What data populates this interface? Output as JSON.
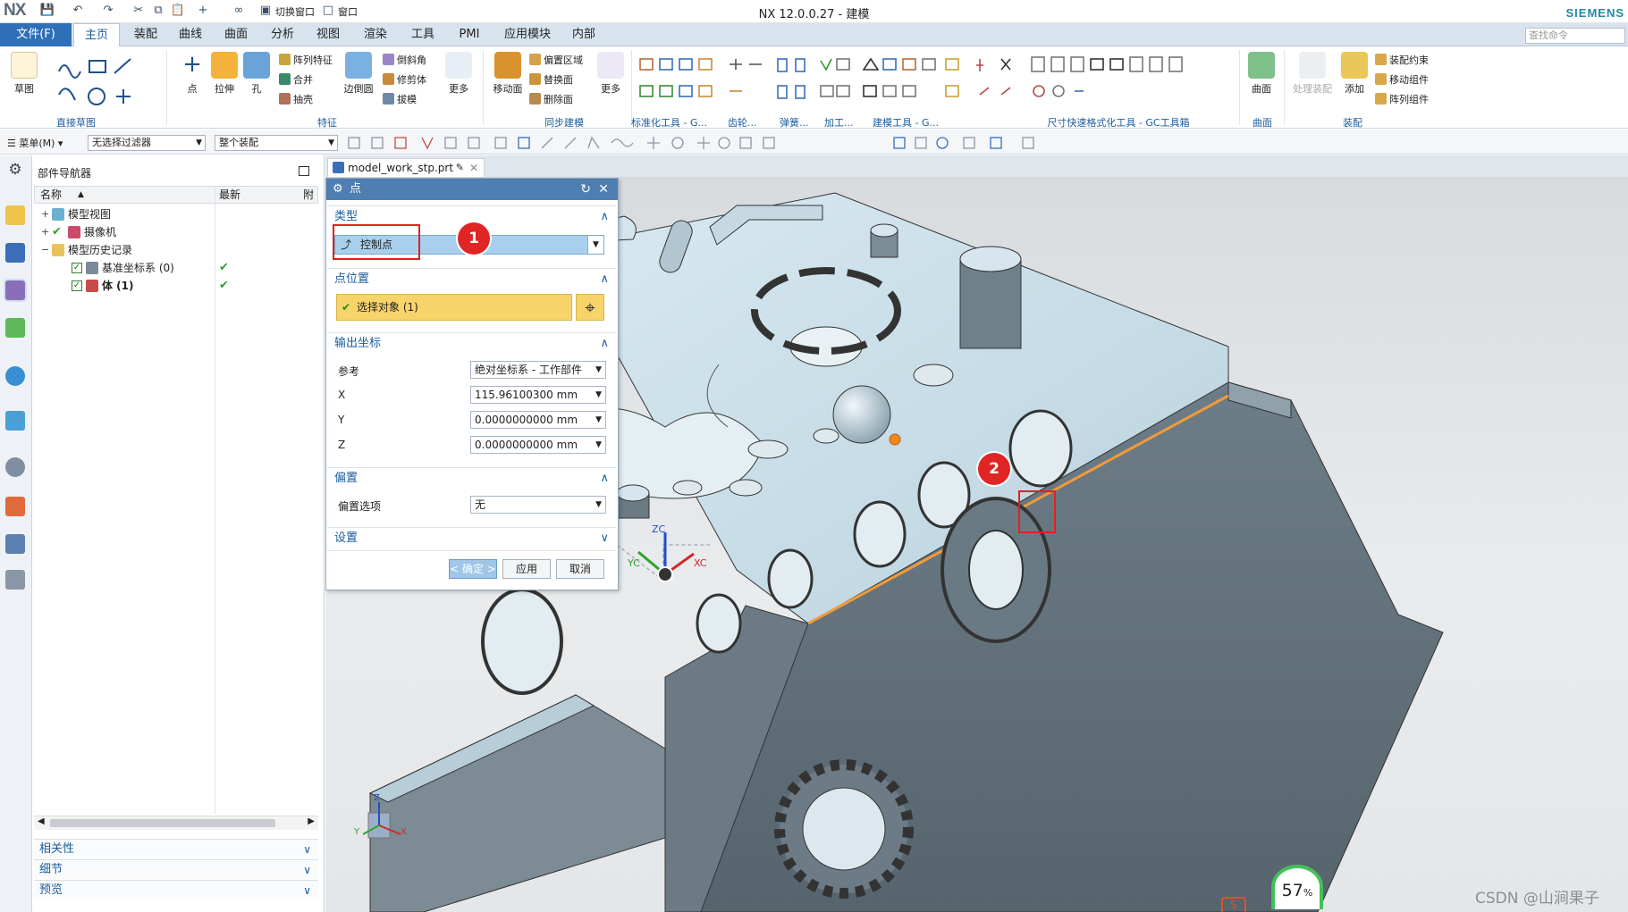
{
  "titlebar": {
    "logo": "NX",
    "title": "NX 12.0.0.27 - 建模",
    "brand": "SIEMENS",
    "switch_window": "切换窗口",
    "window_menu": "窗口"
  },
  "menubar": {
    "file": "文件(F)",
    "tabs": [
      "主页",
      "装配",
      "曲线",
      "曲面",
      "分析",
      "视图",
      "渲染",
      "工具",
      "PMI",
      "应用模块",
      "内部"
    ],
    "active_tab": "主页",
    "search_placeholder": "查找命令"
  },
  "ribbon": {
    "groups": [
      {
        "label": "直接草图",
        "buttons": [
          "草图"
        ]
      },
      {
        "label": "特征",
        "buttons": [
          "点",
          "拉伸",
          "孔",
          "边倒圆",
          "更多"
        ],
        "small": [
          "阵列特征",
          "合并",
          "抽壳",
          "倒斜角",
          "修剪体",
          "拔模"
        ]
      },
      {
        "label": "同步建模",
        "buttons": [
          "移动面",
          "更多"
        ],
        "small": [
          "偏置区域",
          "替换面",
          "删除面"
        ]
      },
      {
        "label": "标准化工具 - G...",
        "buttons": []
      },
      {
        "label": "齿轮...",
        "buttons": []
      },
      {
        "label": "弹簧...",
        "buttons": []
      },
      {
        "label": "加工...",
        "buttons": []
      },
      {
        "label": "建模工具 - G...",
        "buttons": []
      },
      {
        "label": "尺寸快速格式化工具 - GC工具箱",
        "buttons": []
      },
      {
        "label": "曲面",
        "buttons": [
          "曲面"
        ]
      },
      {
        "label": "装配",
        "buttons": [
          "处理装配",
          "添加"
        ],
        "small": [
          "装配约束",
          "移动组件",
          "阵列组件"
        ]
      }
    ]
  },
  "selbar": {
    "menu": "菜单(M)",
    "filter": "无选择过滤器",
    "scope": "整个装配"
  },
  "navigator": {
    "title": "部件导航器",
    "columns": [
      "名称",
      "最新",
      "附"
    ],
    "rows": [
      {
        "toggle": "+",
        "label": "模型视图",
        "checked": false,
        "ok": false
      },
      {
        "toggle": "+",
        "label": "摄像机",
        "checked": true,
        "ok": false
      },
      {
        "toggle": "−",
        "label": "模型历史记录",
        "checked": false,
        "ok": false
      },
      {
        "toggle": "",
        "label": "基准坐标系 (0)",
        "checked": true,
        "ok": true
      },
      {
        "toggle": "",
        "label": "体 (1)",
        "checked": true,
        "ok": true
      }
    ],
    "accordions": [
      "相关性",
      "细节",
      "预览"
    ]
  },
  "doc_tab": {
    "name": "model_work_stp.prt"
  },
  "dialog": {
    "title": "点",
    "type_section": "类型",
    "type_value": "控制点",
    "point_section": "点位置",
    "select_object": "选择对象 (1)",
    "output_section": "输出坐标",
    "reference_label": "参考",
    "reference_value": "绝对坐标系 - 工作部件",
    "x_label": "X",
    "x_value": "115.96100300",
    "x_unit": "mm",
    "y_label": "Y",
    "y_value": "0.0000000000",
    "y_unit": "mm",
    "z_label": "Z",
    "z_value": "0.0000000000",
    "z_unit": "mm",
    "offset_section": "偏置",
    "offset_label": "偏置选项",
    "offset_value": "无",
    "settings_section": "设置",
    "ok": "< 确定 >",
    "apply": "应用",
    "cancel": "取消"
  },
  "callouts": [
    "1",
    "2"
  ],
  "axes": {
    "zc": "ZC",
    "yc": "YC",
    "xc": "XC",
    "z": "Z",
    "y": "Y",
    "x": "X"
  },
  "status": {
    "progress": "57",
    "progress_unit": "%"
  },
  "watermark": "CSDN @山涧果子",
  "colors": {
    "accent": "#2e6fb7",
    "dialog_title": "#4f7fb0",
    "highlight": "#f7d36a",
    "edge": "#f29a3a",
    "callout": "#e12424",
    "model": "#5e6e78",
    "top_face": "#c5dbe6"
  }
}
